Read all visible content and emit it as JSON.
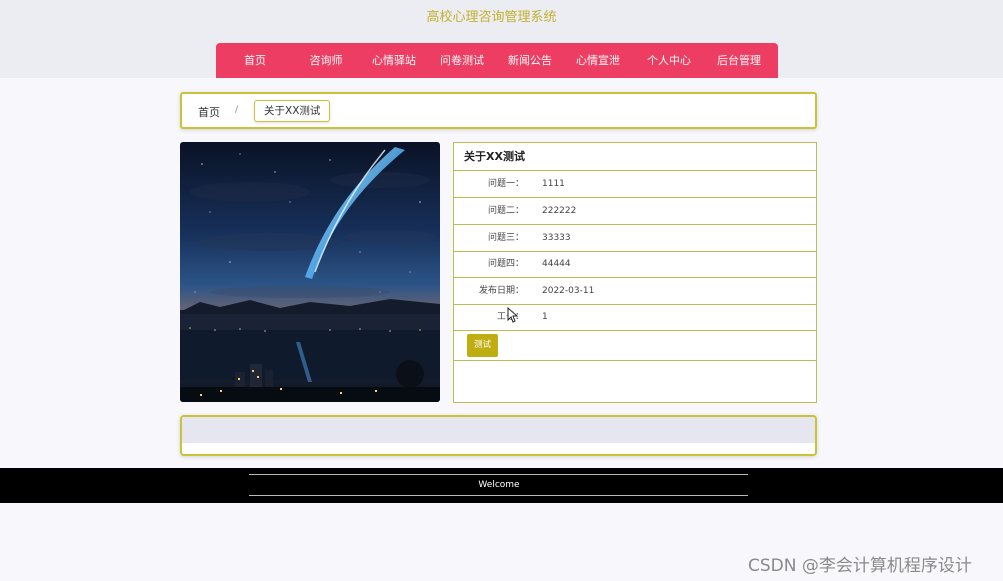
{
  "site": {
    "title": "高校心理咨询管理系统"
  },
  "nav": {
    "items": [
      {
        "label": "首页"
      },
      {
        "label": "咨询师"
      },
      {
        "label": "心情驿站"
      },
      {
        "label": "问卷测试"
      },
      {
        "label": "新闻公告"
      },
      {
        "label": "心情宣泄"
      },
      {
        "label": "个人中心"
      },
      {
        "label": "后台管理"
      }
    ]
  },
  "breadcrumb": {
    "home": "首页",
    "separator": "/",
    "current": "关于XX测试"
  },
  "detail": {
    "title": "关于XX测试",
    "rows": [
      {
        "label": "问题一：",
        "value": "1111"
      },
      {
        "label": "问题二：",
        "value": "222222"
      },
      {
        "label": "问题三：",
        "value": "33333"
      },
      {
        "label": "问题四：",
        "value": "44444"
      },
      {
        "label": "发布日期：",
        "value": "2022-03-11"
      },
      {
        "label": "工号：",
        "value": "1"
      }
    ],
    "button_label": "测试"
  },
  "footer": {
    "text": "Welcome"
  },
  "watermark": "CSDN @李会计算机程序设计",
  "colors": {
    "nav": "#ee3d63",
    "accent": "#c8c337",
    "button": "#bfae12",
    "title": "#c2b12e"
  }
}
